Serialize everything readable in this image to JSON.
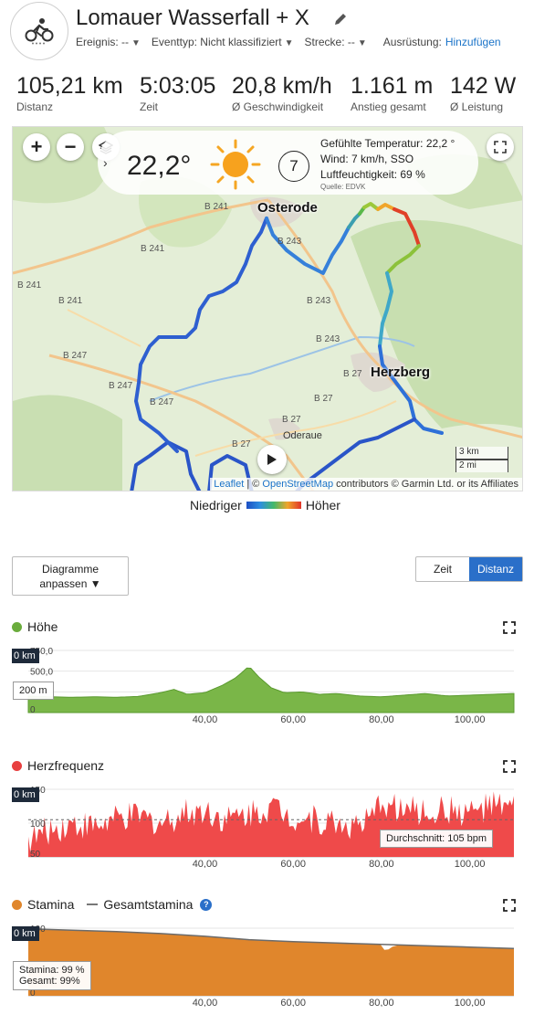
{
  "activity": {
    "title": "Lomauer Wasserfall + X",
    "avatar_icon": "cyclist-icon",
    "meta": [
      {
        "label": "Ereignis: --"
      },
      {
        "label": "Eventtyp: Nicht klassifiziert"
      },
      {
        "label": "Strecke: --"
      }
    ],
    "equipment_label": "Ausrüstung:",
    "equipment_action": "Hinzufügen"
  },
  "stats": [
    {
      "value": "105,21 km",
      "label": "Distanz"
    },
    {
      "value": "5:03:05",
      "label": "Zeit"
    },
    {
      "value": "20,8 km/h",
      "label": "Ø Geschwindigkeit"
    },
    {
      "value": "1.161 m",
      "label": "Anstieg gesamt"
    },
    {
      "value": "142 W",
      "label": "Ø Leistung"
    }
  ],
  "map": {
    "weather": {
      "temperature": "22,2°",
      "wind_speed": "7",
      "felt": "Gefühlte Temperatur: 22,2 °",
      "wind": "Wind: 7 km/h, SSO",
      "humidity": "Luftfeuchtigkeit: 69 %",
      "source": "Quelle: EDVK"
    },
    "places": [
      "Osterode",
      "Herzberg",
      "Oderaue"
    ],
    "roads": [
      "B 241",
      "B 241",
      "B 241",
      "B 247",
      "B 247",
      "B 247",
      "B 243",
      "B 243",
      "B 27",
      "B 27",
      "B 27",
      "B 27",
      "B 241",
      "B 243"
    ],
    "scale": [
      "3 km",
      "2 mi"
    ],
    "attribution_leaflet": "Leaflet",
    "attribution_sep": " | © ",
    "attribution_osm": "OpenStreetMap",
    "attribution_rest": " contributors © Garmin Ltd. or its Affiliates",
    "legend_low": "Niedriger",
    "legend_high": "Höher"
  },
  "controls": {
    "customize_line1": "Diagramme",
    "customize_line2": "anpassen ▼",
    "toggle_time": "Zeit",
    "toggle_distance": "Distanz",
    "active": "Distanz"
  },
  "charts": {
    "elevation": {
      "title": "Höhe",
      "color": "#6aac3c",
      "km_tag": "0 km",
      "tooltip": "200 m",
      "y_labels": [
        "750,0",
        "500,0",
        "0"
      ],
      "x_labels": [
        "40,00",
        "60,00",
        "80,00",
        "100,00"
      ]
    },
    "heartrate": {
      "title": "Herzfrequenz",
      "color": "#e84040",
      "km_tag": "0 km",
      "tooltip": "Durchschnitt: 105 bpm",
      "y_labels": [
        "150",
        "100",
        "50"
      ],
      "x_labels": [
        "40,00",
        "60,00",
        "80,00",
        "100,00"
      ]
    },
    "stamina": {
      "title": "Stamina",
      "title2": "Gesamtstamina",
      "color": "#e0862c",
      "km_tag": "0 km",
      "tooltip_line1": "Stamina: 99 %",
      "tooltip_line2": "Gesamt: 99%",
      "y_labels": [
        "100",
        "0"
      ],
      "x_labels": [
        "40,00",
        "60,00",
        "80,00",
        "100,00"
      ]
    }
  },
  "chart_data": [
    {
      "type": "area",
      "title": "Höhe",
      "xlabel": "",
      "ylabel": "",
      "x": [
        0,
        5,
        10,
        15,
        20,
        25,
        30,
        33,
        36,
        40,
        44,
        47,
        50,
        52,
        55,
        58,
        62,
        66,
        70,
        75,
        80,
        85,
        90,
        95,
        100,
        105,
        110
      ],
      "values": [
        200,
        190,
        185,
        190,
        185,
        195,
        240,
        280,
        220,
        240,
        330,
        420,
        560,
        440,
        300,
        240,
        250,
        220,
        230,
        200,
        190,
        210,
        230,
        200,
        210,
        220,
        230
      ],
      "ylim": [
        0,
        750
      ],
      "xlim": [
        0,
        110
      ]
    },
    {
      "type": "area",
      "title": "Herzfrequenz",
      "xlabel": "",
      "ylabel": "",
      "x": [
        0,
        5,
        10,
        15,
        20,
        25,
        30,
        35,
        40,
        45,
        50,
        55,
        60,
        65,
        70,
        75,
        78,
        80,
        82,
        85,
        90,
        95,
        100,
        105,
        110
      ],
      "values": [
        75,
        90,
        100,
        95,
        105,
        110,
        100,
        115,
        120,
        105,
        115,
        125,
        110,
        105,
        100,
        95,
        105,
        135,
        125,
        120,
        115,
        120,
        115,
        125,
        120
      ],
      "average": 105,
      "ylim": [
        50,
        150
      ],
      "xlim": [
        0,
        110
      ]
    },
    {
      "type": "area",
      "title": "Stamina",
      "xlabel": "",
      "ylabel": "",
      "series": [
        {
          "name": "Stamina",
          "x": [
            0,
            10,
            20,
            30,
            40,
            50,
            60,
            70,
            80,
            81,
            82,
            84,
            90,
            100,
            110
          ],
          "values": [
            99,
            97,
            95,
            92,
            88,
            83,
            80,
            78,
            76,
            64,
            72,
            75,
            74,
            72,
            70
          ]
        },
        {
          "name": "Gesamtstamina",
          "x": [
            0,
            10,
            20,
            30,
            40,
            50,
            60,
            70,
            80,
            90,
            100,
            110
          ],
          "values": [
            99,
            97,
            95,
            92,
            88,
            83,
            80,
            78,
            76,
            74,
            72,
            70
          ]
        }
      ],
      "ylim": [
        0,
        100
      ],
      "xlim": [
        0,
        110
      ]
    }
  ]
}
